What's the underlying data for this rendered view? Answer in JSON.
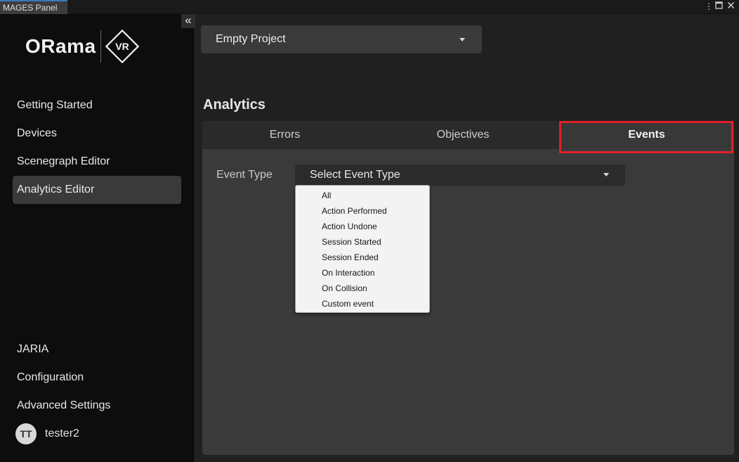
{
  "window": {
    "tab_title": "MAGES Panel",
    "controls": {
      "menu": "⋮",
      "maximize": "🗖",
      "close": "✕"
    }
  },
  "sidebar": {
    "collapse_glyph": "«",
    "logo": {
      "wordmark": "ORama",
      "badge": "VR"
    },
    "nav_top": [
      {
        "label": "Getting Started"
      },
      {
        "label": "Devices"
      },
      {
        "label": "Scenegraph Editor"
      },
      {
        "label": "Analytics Editor",
        "active": true
      }
    ],
    "nav_bottom": [
      {
        "label": "JARIA"
      },
      {
        "label": "Configuration"
      },
      {
        "label": "Advanced Settings"
      }
    ],
    "user": {
      "initials": "TT",
      "name": "tester2"
    }
  },
  "main": {
    "project_dropdown": {
      "value": "Empty Project"
    },
    "section_title": "Analytics",
    "tabs": [
      {
        "label": "Errors"
      },
      {
        "label": "Objectives"
      },
      {
        "label": "Events",
        "active": true
      }
    ],
    "event_type": {
      "label": "Event Type",
      "value": "Select Event Type",
      "options": [
        "All",
        "Action Performed",
        "Action Undone",
        "Session Started",
        "Session Ended",
        "On Interaction",
        "On Collision",
        "Custom event"
      ]
    }
  },
  "colors": {
    "highlight": "#e0202a",
    "sidebar_bg": "#0d0d0d",
    "panel_bg": "#3a3a3a",
    "menu_bg": "#f3f3f3"
  }
}
